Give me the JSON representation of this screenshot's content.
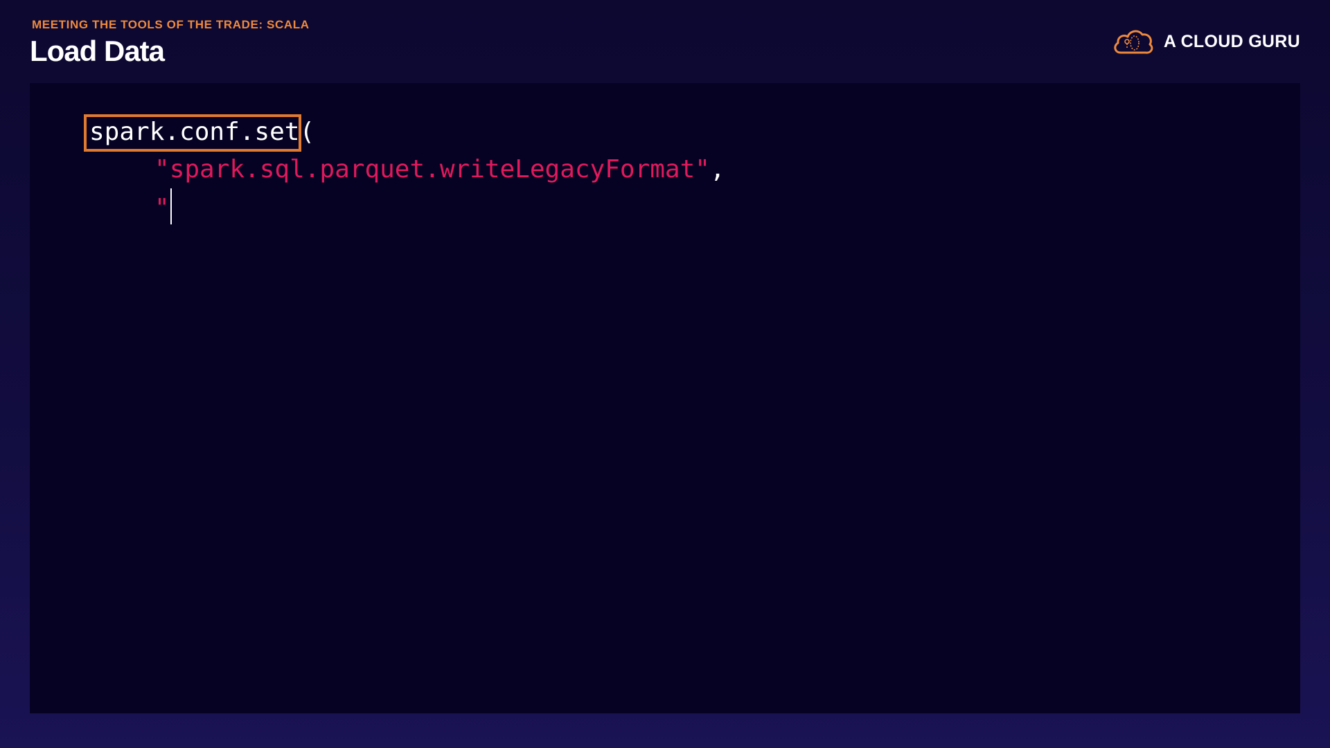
{
  "header": {
    "eyebrow": "MEETING THE TOOLS OF THE TRADE: SCALA",
    "title": "Load Data",
    "brand_name": "A CLOUD GURU",
    "brand_icon": "cloud-logo-icon"
  },
  "colors": {
    "accent": "#f08a3c",
    "string": "#e0195c",
    "code_bg": "#060223"
  },
  "code": {
    "line1_call": "spark.conf.set",
    "line1_paren": "(",
    "line2_open_quote": "\"",
    "line2_key": "spark.sql.parquet.writeLegacyFormat",
    "line2_close_quote": "\"",
    "line2_comma": ",",
    "line3_quote": "\""
  }
}
